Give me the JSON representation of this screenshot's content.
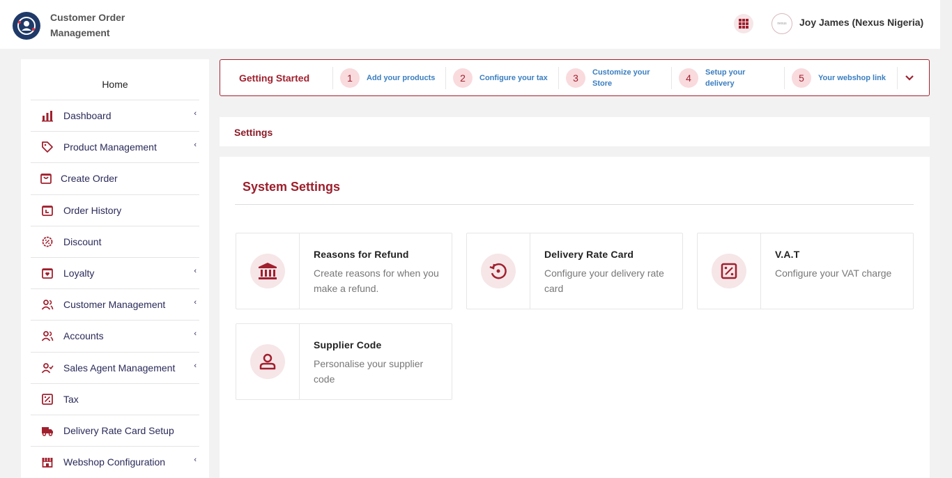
{
  "header": {
    "app_title": "Customer Order Management",
    "user_name": "Joy James (Nexus Nigeria)",
    "avatar_text": "nexus"
  },
  "sidebar": {
    "home": "Home",
    "items": [
      {
        "label": "Dashboard",
        "icon": "bar-chart-icon",
        "expandable": true
      },
      {
        "label": "Product Management",
        "icon": "tag-icon",
        "expandable": true
      },
      {
        "label": "Create Order",
        "icon": "shopping-bag-icon",
        "expandable": false
      },
      {
        "label": "Order History",
        "icon": "order-history-icon",
        "expandable": false
      },
      {
        "label": "Discount",
        "icon": "discount-icon",
        "expandable": false
      },
      {
        "label": "Loyalty",
        "icon": "loyalty-bag-icon",
        "expandable": true
      },
      {
        "label": "Customer Management",
        "icon": "users-icon",
        "expandable": true
      },
      {
        "label": "Accounts",
        "icon": "users-icon",
        "expandable": true
      },
      {
        "label": "Sales Agent Management",
        "icon": "user-check-icon",
        "expandable": true
      },
      {
        "label": "Tax",
        "icon": "percent-icon",
        "expandable": false
      },
      {
        "label": "Delivery Rate Card Setup",
        "icon": "truck-icon",
        "expandable": false
      },
      {
        "label": "Webshop Configuration",
        "icon": "store-icon",
        "expandable": true
      }
    ]
  },
  "getting_started": {
    "title": "Getting Started",
    "steps": [
      {
        "num": "1",
        "label": "Add your products"
      },
      {
        "num": "2",
        "label": "Configure your tax"
      },
      {
        "num": "3",
        "label": "Customize your Store"
      },
      {
        "num": "4",
        "label": "Setup your delivery"
      },
      {
        "num": "5",
        "label": "Your webshop link"
      }
    ]
  },
  "breadcrumb": "Settings",
  "main": {
    "title": "System Settings",
    "cards": [
      {
        "title": "Reasons for Refund",
        "desc": "Create reasons for when you make a refund.",
        "icon": "bank-icon"
      },
      {
        "title": "Delivery Rate Card",
        "desc": "Configure your delivery rate card",
        "icon": "history-icon"
      },
      {
        "title": "V.A.T",
        "desc": "Configure your VAT charge",
        "icon": "percent-icon"
      },
      {
        "title": "Supplier Code",
        "desc": "Personalise your supplier code",
        "icon": "user-icon"
      }
    ]
  },
  "colors": {
    "accent": "#a0202e",
    "step_link": "#3a7ec0",
    "nav_text": "#2a2a5a",
    "icon_bg": "#f6e6e8"
  }
}
